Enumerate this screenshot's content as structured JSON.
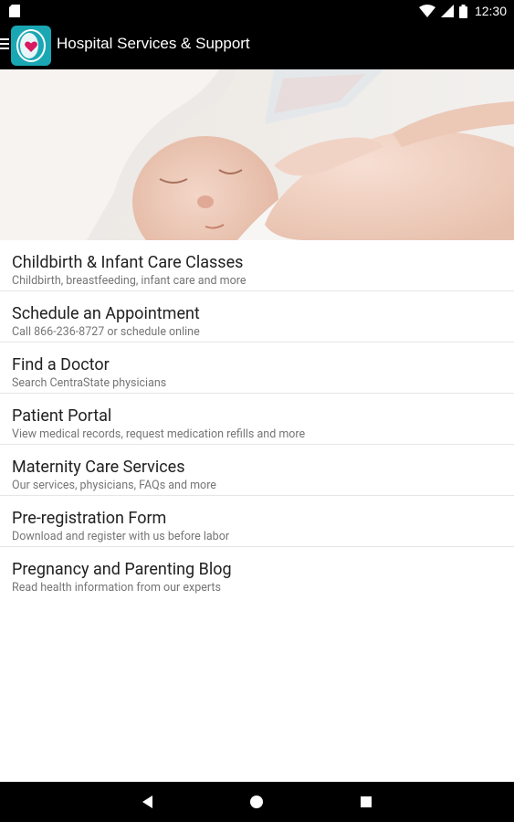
{
  "status_bar": {
    "time": "12:30",
    "icons": [
      "sd-card-icon",
      "wifi-icon",
      "signal-icon",
      "battery-icon"
    ]
  },
  "app_bar": {
    "title": "Hospital Services & Support",
    "menu_icon": "menu-icon",
    "logo": "heart-logo"
  },
  "hero": {
    "image": "newborn-baby-photo"
  },
  "menu": {
    "items": [
      {
        "title": "Childbirth & Infant Care Classes",
        "subtitle": "Childbirth, breastfeeding, infant care and more"
      },
      {
        "title": "Schedule an Appointment",
        "subtitle": "Call 866-236-8727 or schedule online"
      },
      {
        "title": "Find a Doctor",
        "subtitle": "Search CentraState physicians"
      },
      {
        "title": "Patient Portal",
        "subtitle": "View medical records, request medication refills and more"
      },
      {
        "title": "Maternity Care Services",
        "subtitle": "Our services, physicians, FAQs and more"
      },
      {
        "title": "Pre-registration Form",
        "subtitle": "Download and register with us before labor"
      },
      {
        "title": "Pregnancy and Parenting Blog",
        "subtitle": "Read health information from our experts"
      }
    ]
  },
  "nav_bar": {
    "buttons": [
      "back-icon",
      "home-icon",
      "recents-icon"
    ]
  },
  "colors": {
    "status_bar": "#000000",
    "app_bar": "#000000",
    "logo_bg": "#1aa7b4",
    "heart": "#d81b60",
    "title_text": "#212121",
    "subtitle_text": "#757575",
    "divider": "#e6e6e6"
  }
}
